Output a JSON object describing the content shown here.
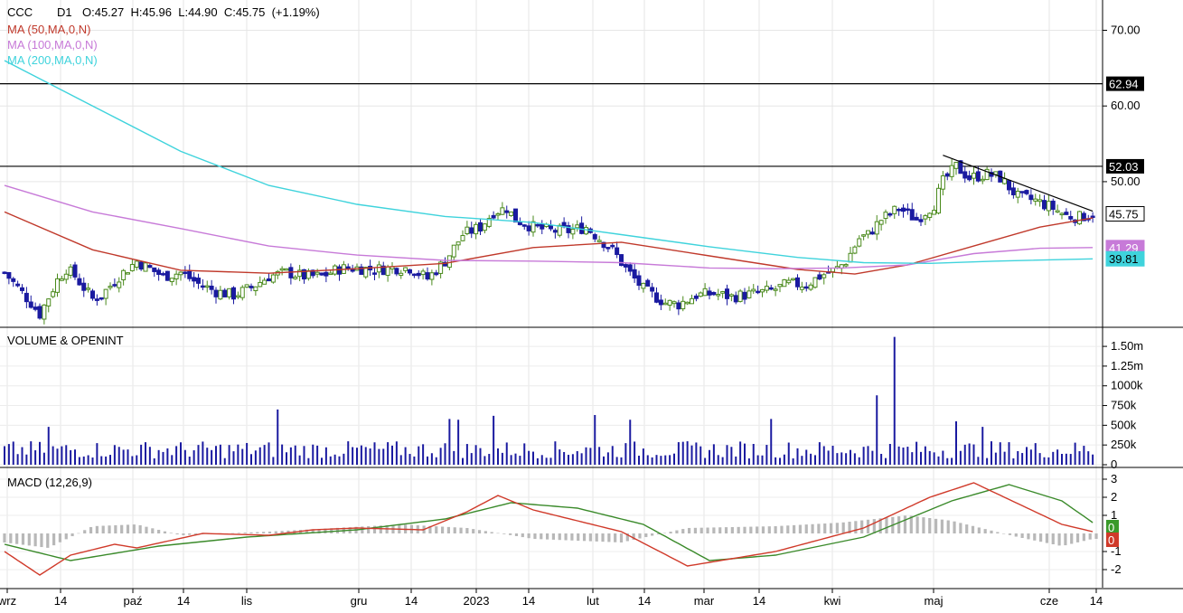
{
  "header": {
    "symbol": "CCC",
    "period": "D1",
    "ohlc": "O:45.27  H:45.96  L:44.90  C:45.75  (+1.19%)"
  },
  "legend": [
    {
      "label": "MA (50,MA,0,N)",
      "color": "#c0392b"
    },
    {
      "label": "MA (100,MA,0,N)",
      "color": "#c77ad8"
    },
    {
      "label": "MA (200,MA,0,N)",
      "color": "#3fd3dc"
    }
  ],
  "panels": {
    "volume_title": "VOLUME & OPENINT",
    "macd_title": "MACD (12,26,9)"
  },
  "colors": {
    "up": "#4a8a1c",
    "down": "#1a1aa0",
    "volume": "#1a1aa0",
    "macd_line": "#d03a2a",
    "signal_line": "#3a8a2a",
    "histogram": "#b8b8b8",
    "hline": "#000000"
  },
  "chart_data": [
    {
      "type": "candlestick",
      "y_ticks": [
        "70.00",
        "60.00",
        "50.00"
      ],
      "ylim": [
        31,
        74
      ],
      "horizontal_levels": [
        {
          "value": 62.94,
          "label": "62.94",
          "style": "black"
        },
        {
          "value": 52.03,
          "label": "52.03",
          "style": "black"
        }
      ],
      "right_labels": [
        {
          "value": 45.75,
          "label": "45.75",
          "style": "outlined"
        },
        {
          "value": 41.29,
          "label": "41.29",
          "style": "violet"
        },
        {
          "value": 39.81,
          "label": "39.81",
          "style": "cyan"
        }
      ],
      "trendline": [
        {
          "x": 213,
          "y": 53.5
        },
        {
          "x": 247,
          "y": 46.1
        }
      ],
      "ma_series": [
        {
          "name": "MA (50,MA,0,N)",
          "color": "#c0392b",
          "points": [
            [
              0,
              46.0
            ],
            [
              20,
              41.0
            ],
            [
              40,
              38.3
            ],
            [
              60,
              37.9
            ],
            [
              80,
              38.5
            ],
            [
              100,
              39.2
            ],
            [
              120,
              41.3
            ],
            [
              140,
              42.0
            ],
            [
              160,
              40.2
            ],
            [
              180,
              38.4
            ],
            [
              193,
              37.8
            ],
            [
              205,
              39.0
            ],
            [
              220,
              41.5
            ],
            [
              235,
              44.0
            ],
            [
              247,
              45.2
            ]
          ]
        },
        {
          "name": "MA (100,MA,0,N)",
          "color": "#c77ad8",
          "points": [
            [
              0,
              49.5
            ],
            [
              20,
              46.0
            ],
            [
              40,
              43.8
            ],
            [
              60,
              41.5
            ],
            [
              80,
              40.3
            ],
            [
              100,
              39.6
            ],
            [
              120,
              39.5
            ],
            [
              140,
              39.3
            ],
            [
              160,
              38.6
            ],
            [
              175,
              38.5
            ],
            [
              190,
              38.6
            ],
            [
              205,
              39.0
            ],
            [
              220,
              40.5
            ],
            [
              235,
              41.2
            ],
            [
              247,
              41.3
            ]
          ]
        },
        {
          "name": "MA (200,MA,0,N)",
          "color": "#3fd3dc",
          "points": [
            [
              0,
              66.0
            ],
            [
              20,
              60.0
            ],
            [
              40,
              54.0
            ],
            [
              60,
              49.5
            ],
            [
              80,
              47.0
            ],
            [
              100,
              45.4
            ],
            [
              120,
              44.6
            ],
            [
              140,
              43.0
            ],
            [
              160,
              41.4
            ],
            [
              180,
              40.0
            ],
            [
              195,
              39.3
            ],
            [
              210,
              39.2
            ],
            [
              225,
              39.5
            ],
            [
              247,
              39.8
            ]
          ]
        }
      ]
    },
    {
      "type": "bar",
      "title": "VOLUME & OPENINT",
      "y_ticks": [
        "1.50m",
        "1.25m",
        "1000k",
        "750k",
        "500k",
        "250k",
        "0"
      ],
      "ylim": [
        0,
        1.65
      ]
    },
    {
      "type": "line",
      "title": "MACD (12,26,9)",
      "y_ticks": [
        "3",
        "2",
        "1",
        "-1",
        "-2"
      ],
      "ylim": [
        -2.6,
        3.2
      ],
      "right_labels": [
        {
          "value": 0.35,
          "label": "0",
          "style": "green"
        },
        {
          "value": -0.35,
          "label": "0",
          "style": "red"
        }
      ],
      "macd": [
        [
          0,
          -1.0
        ],
        [
          8,
          -2.3
        ],
        [
          15,
          -1.2
        ],
        [
          25,
          -0.6
        ],
        [
          30,
          -0.8
        ],
        [
          45,
          0.0
        ],
        [
          60,
          -0.1
        ],
        [
          70,
          0.2
        ],
        [
          80,
          0.3
        ],
        [
          95,
          0.2
        ],
        [
          105,
          1.2
        ],
        [
          112,
          2.1
        ],
        [
          120,
          1.3
        ],
        [
          140,
          0.1
        ],
        [
          155,
          -1.8
        ],
        [
          175,
          -1.0
        ],
        [
          195,
          0.3
        ],
        [
          210,
          2.0
        ],
        [
          220,
          2.8
        ],
        [
          240,
          0.5
        ],
        [
          247,
          0.1
        ]
      ],
      "signal": [
        [
          0,
          -0.6
        ],
        [
          15,
          -1.5
        ],
        [
          35,
          -0.7
        ],
        [
          55,
          -0.2
        ],
        [
          80,
          0.2
        ],
        [
          100,
          0.8
        ],
        [
          115,
          1.7
        ],
        [
          130,
          1.4
        ],
        [
          145,
          0.5
        ],
        [
          160,
          -1.5
        ],
        [
          175,
          -1.2
        ],
        [
          195,
          -0.2
        ],
        [
          215,
          1.8
        ],
        [
          228,
          2.7
        ],
        [
          240,
          1.8
        ],
        [
          247,
          0.6
        ]
      ],
      "histogram": [
        [
          0,
          -0.5
        ],
        [
          10,
          -0.8
        ],
        [
          20,
          0.4
        ],
        [
          30,
          0.5
        ],
        [
          40,
          -0.1
        ],
        [
          60,
          0.1
        ],
        [
          90,
          0.5
        ],
        [
          105,
          0.3
        ],
        [
          120,
          -0.3
        ],
        [
          140,
          -0.5
        ],
        [
          155,
          0.3
        ],
        [
          175,
          0.4
        ],
        [
          190,
          0.6
        ],
        [
          205,
          1.0
        ],
        [
          215,
          0.7
        ],
        [
          230,
          -0.2
        ],
        [
          240,
          -0.7
        ],
        [
          247,
          -0.3
        ]
      ]
    }
  ],
  "x_axis": {
    "labels": [
      {
        "text": "wrz",
        "x": 8
      },
      {
        "text": "14",
        "x": 67
      },
      {
        "text": "paź",
        "x": 147
      },
      {
        "text": "14",
        "x": 203
      },
      {
        "text": "lis",
        "x": 273
      },
      {
        "text": "gru",
        "x": 397
      },
      {
        "text": "14",
        "x": 455
      },
      {
        "text": "2023",
        "x": 527
      },
      {
        "text": "14",
        "x": 585
      },
      {
        "text": "lut",
        "x": 656
      },
      {
        "text": "14",
        "x": 713
      },
      {
        "text": "mar",
        "x": 779
      },
      {
        "text": "14",
        "x": 840
      },
      {
        "text": "kwi",
        "x": 921
      },
      {
        "text": "maj",
        "x": 1033
      },
      {
        "text": "cze",
        "x": 1161
      },
      {
        "text": "14",
        "x": 1213
      }
    ]
  }
}
